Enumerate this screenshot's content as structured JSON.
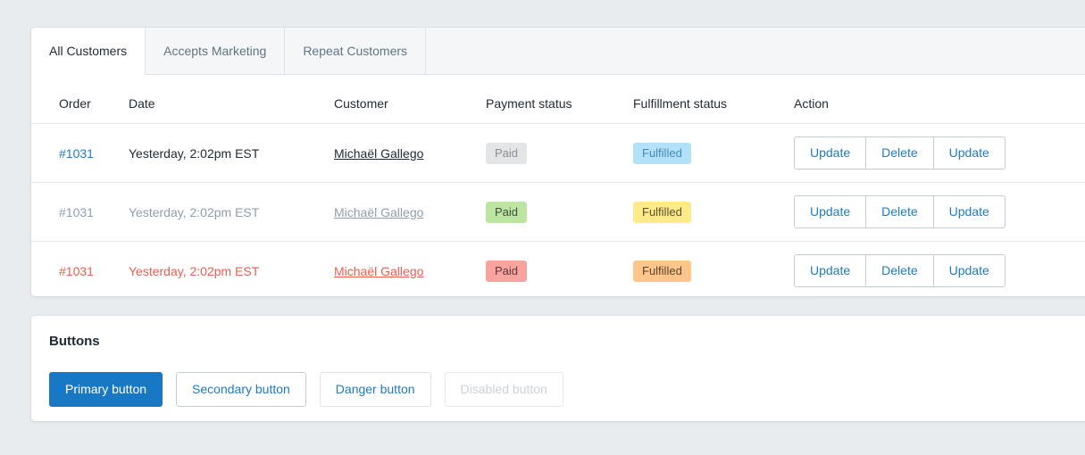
{
  "theme": {
    "page_bg": "#e8ecef",
    "card_bg": "#ffffff",
    "accent": "#1878c4",
    "link": "#1f7bc1",
    "text": "#212b36",
    "subdued": "#919eab",
    "critical": "#e9604f",
    "border": "#dfe3e8"
  },
  "orders_card": {
    "tabs": [
      {
        "label": "All Customers",
        "active": true
      },
      {
        "label": "Accepts Marketing",
        "active": false
      },
      {
        "label": "Repeat Customers",
        "active": false
      }
    ],
    "table": {
      "columns": [
        "Order",
        "Date",
        "Customer",
        "Payment status",
        "Fulfillment status",
        "Action"
      ],
      "rows": [
        {
          "tone": "default",
          "order": "#1031",
          "date": "Yesterday, 2:02pm EST",
          "customer": "Michaël Gallego",
          "payment_status": {
            "label": "Paid",
            "style": "default"
          },
          "fulfillment_status": {
            "label": "Fulfilled",
            "style": "info"
          },
          "actions": [
            "Update",
            "Delete",
            "Update"
          ]
        },
        {
          "tone": "subdued",
          "order": "#1031",
          "date": "Yesterday, 2:02pm EST",
          "customer": "Michaël Gallego",
          "payment_status": {
            "label": "Paid",
            "style": "success"
          },
          "fulfillment_status": {
            "label": "Fulfilled",
            "style": "attention"
          },
          "actions": [
            "Update",
            "Delete",
            "Update"
          ]
        },
        {
          "tone": "critical",
          "order": "#1031",
          "date": "Yesterday, 2:02pm EST",
          "customer": "Michaël Gallego",
          "payment_status": {
            "label": "Paid",
            "style": "critical2"
          },
          "fulfillment_status": {
            "label": "Fulfilled",
            "style": "warning"
          },
          "actions": [
            "Update",
            "Delete",
            "Update"
          ]
        }
      ]
    }
  },
  "buttons_card": {
    "title": "Buttons",
    "buttons": [
      {
        "label": "Primary button",
        "variant": "primary",
        "disabled": false
      },
      {
        "label": "Secondary button",
        "variant": "secondary",
        "disabled": false
      },
      {
        "label": "Danger button",
        "variant": "danger",
        "disabled": false
      },
      {
        "label": "Disabled button",
        "variant": "disabled",
        "disabled": true
      }
    ]
  }
}
